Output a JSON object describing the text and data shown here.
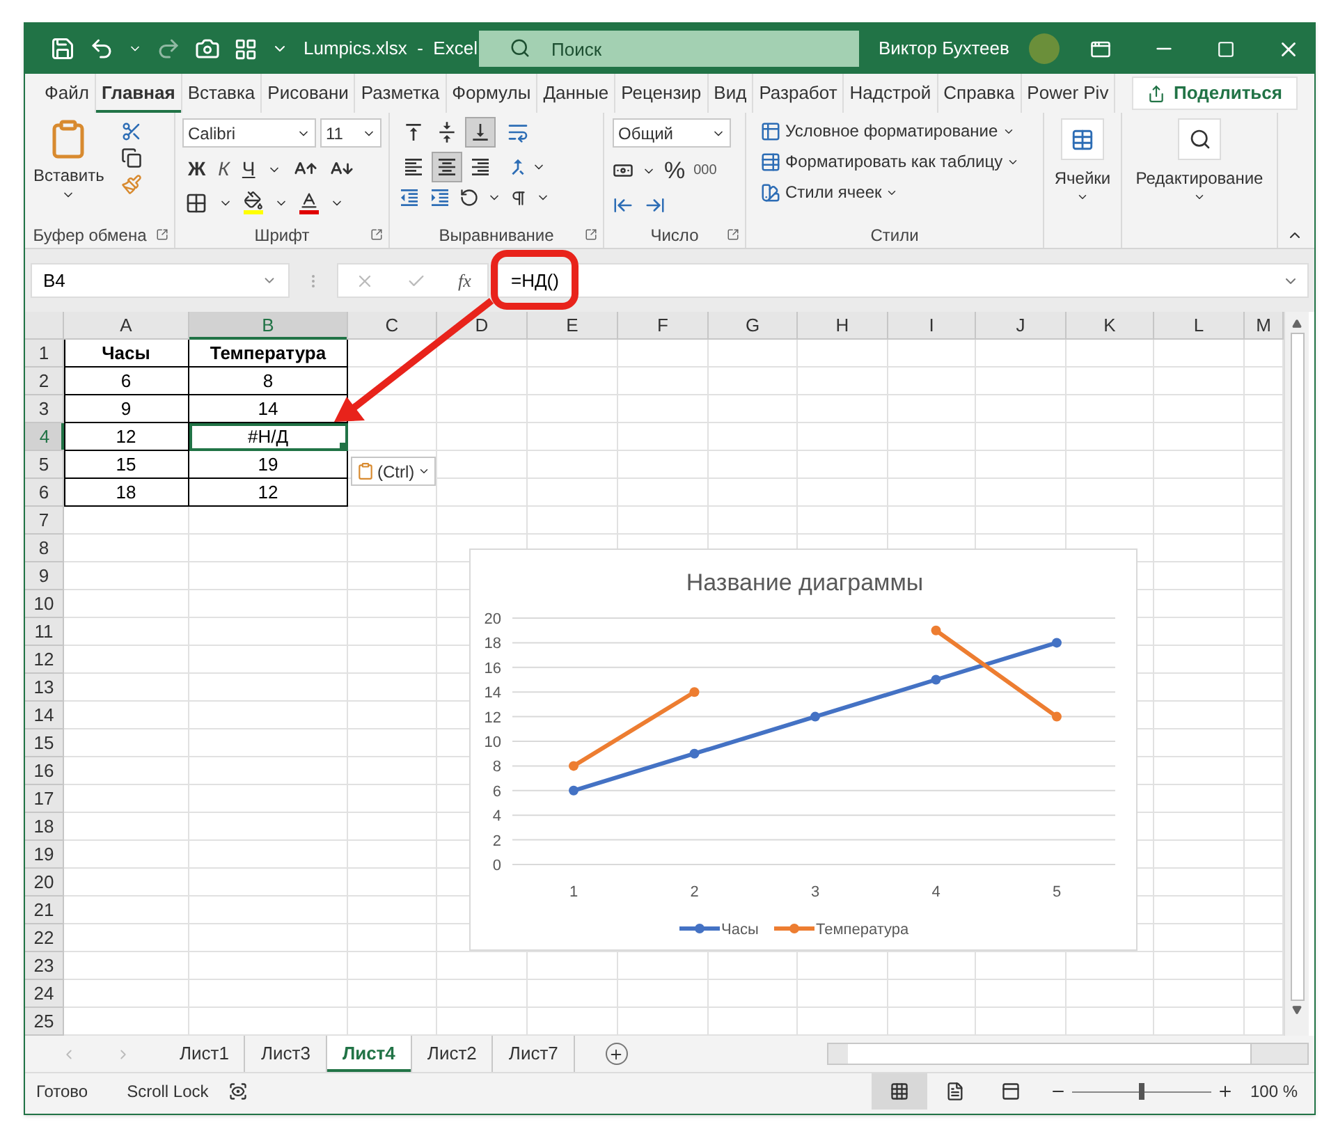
{
  "title_bar": {
    "file_title": "Lumpics.xlsx  -  Excel",
    "search": {
      "placeholder": "Поиск"
    },
    "user_name": "Виктор Бухтеев"
  },
  "ribbon_tabs": [
    {
      "label": "Файл",
      "selected": false
    },
    {
      "label": "Главная",
      "selected": true
    },
    {
      "label": "Вставка",
      "selected": false
    },
    {
      "label": "Рисовани",
      "selected": false
    },
    {
      "label": "Разметка",
      "selected": false
    },
    {
      "label": "Формулы",
      "selected": false
    },
    {
      "label": "Данные",
      "selected": false
    },
    {
      "label": "Рецензир",
      "selected": false
    },
    {
      "label": "Вид",
      "selected": false
    },
    {
      "label": "Разработ",
      "selected": false
    },
    {
      "label": "Надстрой",
      "selected": false
    },
    {
      "label": "Справка",
      "selected": false
    },
    {
      "label": "Power Piv",
      "selected": false
    }
  ],
  "share_button": "Поделиться",
  "ribbon": {
    "clipboard": {
      "paste": "Вставить",
      "label": "Буфер обмена"
    },
    "font": {
      "font_name": "Calibri",
      "font_size": "11",
      "bold": "Ж",
      "italic": "К",
      "underline": "Ч",
      "label": "Шрифт"
    },
    "alignment": {
      "vertical": [
        {
          "selected": false
        },
        {
          "selected": false
        },
        {
          "selected": true
        }
      ],
      "horizontal": [
        {
          "selected": false
        },
        {
          "selected": true
        },
        {
          "selected": false
        }
      ],
      "label": "Выравнивание"
    },
    "number": {
      "format": "Общий",
      "percent": "%",
      "thousands": "000",
      "label": "Число"
    },
    "styles": {
      "items": [
        "Условное форматирование",
        "Форматировать как таблицу",
        "Стили ячеек"
      ],
      "label": "Стили"
    },
    "cells": {
      "label": "Ячейки"
    },
    "editing": {
      "label": "Редактирование"
    }
  },
  "formula_bar": {
    "name_box": "B4",
    "function_button": "fx",
    "formula": "=НД()"
  },
  "sheet": {
    "columns": [
      {
        "label": "A",
        "selected": false
      },
      {
        "label": "B",
        "selected": true
      },
      {
        "label": "C",
        "selected": false
      },
      {
        "label": "D",
        "selected": false
      },
      {
        "label": "E",
        "selected": false
      },
      {
        "label": "F",
        "selected": false
      },
      {
        "label": "G",
        "selected": false
      },
      {
        "label": "H",
        "selected": false
      },
      {
        "label": "I",
        "selected": false
      },
      {
        "label": "J",
        "selected": false
      },
      {
        "label": "K",
        "selected": false
      },
      {
        "label": "L",
        "selected": false
      },
      {
        "label": "M",
        "selected": false
      }
    ],
    "rows": [
      {
        "label": "1",
        "selected": false,
        "kind": "header",
        "cells": [
          {
            "value": "Часы",
            "selected": false
          },
          {
            "value": "Температура",
            "selected": false
          }
        ]
      },
      {
        "label": "2",
        "selected": false,
        "kind": "data",
        "cells": [
          {
            "value": "6",
            "selected": false
          },
          {
            "value": "8",
            "selected": false
          }
        ]
      },
      {
        "label": "3",
        "selected": false,
        "kind": "data",
        "cells": [
          {
            "value": "9",
            "selected": false
          },
          {
            "value": "14",
            "selected": false
          }
        ]
      },
      {
        "label": "4",
        "selected": true,
        "kind": "data",
        "cells": [
          {
            "value": "12",
            "selected": false
          },
          {
            "value": "#Н/Д",
            "selected": true
          }
        ]
      },
      {
        "label": "5",
        "selected": false,
        "kind": "data",
        "cells": [
          {
            "value": "15",
            "selected": false
          },
          {
            "value": "19",
            "selected": false
          }
        ]
      },
      {
        "label": "6",
        "selected": false,
        "kind": "data",
        "cells": [
          {
            "value": "18",
            "selected": false
          },
          {
            "value": "12",
            "selected": false
          }
        ]
      },
      {
        "label": "7",
        "selected": false,
        "kind": "empty"
      },
      {
        "label": "8",
        "selected": false,
        "kind": "empty"
      },
      {
        "label": "9",
        "selected": false,
        "kind": "empty"
      },
      {
        "label": "10",
        "selected": false,
        "kind": "empty"
      },
      {
        "label": "11",
        "selected": false,
        "kind": "empty"
      },
      {
        "label": "12",
        "selected": false,
        "kind": "empty"
      },
      {
        "label": "13",
        "selected": false,
        "kind": "empty"
      },
      {
        "label": "14",
        "selected": false,
        "kind": "empty"
      },
      {
        "label": "15",
        "selected": false,
        "kind": "empty"
      },
      {
        "label": "16",
        "selected": false,
        "kind": "empty"
      },
      {
        "label": "17",
        "selected": false,
        "kind": "empty"
      },
      {
        "label": "18",
        "selected": false,
        "kind": "empty"
      },
      {
        "label": "19",
        "selected": false,
        "kind": "empty"
      },
      {
        "label": "20",
        "selected": false,
        "kind": "empty"
      },
      {
        "label": "21",
        "selected": false,
        "kind": "empty"
      },
      {
        "label": "22",
        "selected": false,
        "kind": "empty"
      },
      {
        "label": "23",
        "selected": false,
        "kind": "empty"
      },
      {
        "label": "24",
        "selected": false,
        "kind": "empty"
      },
      {
        "label": "25",
        "selected": false,
        "kind": "empty"
      }
    ]
  },
  "paste_options": {
    "label": "(Ctrl)"
  },
  "chart": {
    "chart_data": {
      "type": "line",
      "title": "Название диаграммы",
      "categories": [
        "1",
        "2",
        "3",
        "4",
        "5"
      ],
      "series": [
        {
          "name": "Часы",
          "color": "#4472c4",
          "values": [
            6,
            9,
            12,
            15,
            18
          ]
        },
        {
          "name": "Температура",
          "color": "#ed7d31",
          "values": [
            8,
            14,
            null,
            19,
            12
          ]
        }
      ],
      "ylim": [
        0,
        20
      ],
      "yticks": [
        0,
        2,
        4,
        6,
        8,
        10,
        12,
        14,
        16,
        18,
        20
      ],
      "grid": true,
      "legend": "bottom",
      "marker": "circle"
    }
  },
  "sheet_tabs": [
    {
      "label": "Лист1",
      "selected": false
    },
    {
      "label": "Лист3",
      "selected": false
    },
    {
      "label": "Лист4",
      "selected": true
    },
    {
      "label": "Лист2",
      "selected": false
    },
    {
      "label": "Лист7",
      "selected": false
    }
  ],
  "status_bar": {
    "status": "Готово",
    "scroll_lock": "Scroll Lock",
    "view_modes": [
      {
        "selected": true
      },
      {
        "selected": false
      },
      {
        "selected": false
      }
    ],
    "zoom": {
      "level": 0.5,
      "reading": "100 %"
    }
  }
}
